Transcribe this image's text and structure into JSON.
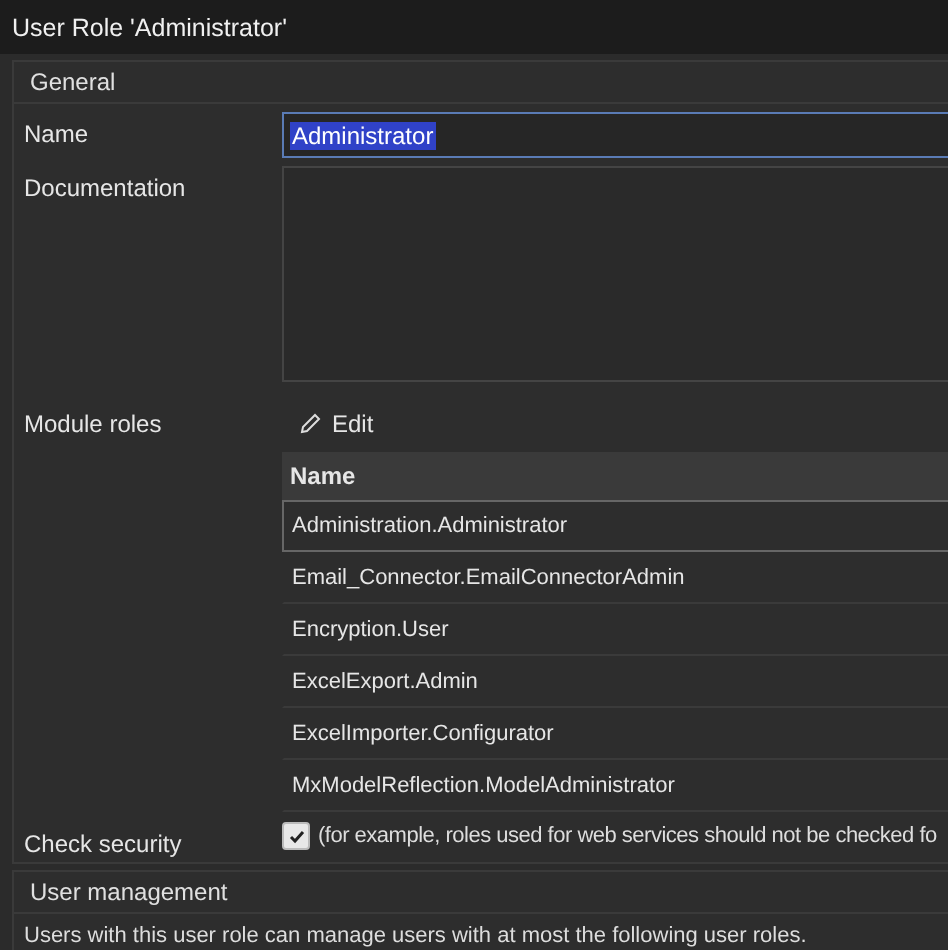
{
  "window": {
    "title": "User Role 'Administrator'"
  },
  "general": {
    "title": "General",
    "name": {
      "label": "Name",
      "value": "Administrator",
      "text_selected": true
    },
    "documentation": {
      "label": "Documentation"
    },
    "module_roles": {
      "label": "Module roles",
      "edit": "Edit",
      "table": {
        "columns": [
          "Name"
        ],
        "rows": [
          {
            "name": "Administration.Administrator",
            "selected": true
          },
          {
            "name": "Email_Connector.EmailConnectorAdmin",
            "selected": false
          },
          {
            "name": "Encryption.User",
            "selected": false
          },
          {
            "name": "ExcelExport.Admin",
            "selected": false
          },
          {
            "name": "ExcelImporter.Configurator",
            "selected": false
          },
          {
            "name": "MxModelReflection.ModelAdministrator",
            "selected": false
          }
        ]
      }
    },
    "check_security": {
      "label": "Check security",
      "checked": true,
      "hint": "(for example, roles used for web services should not be checked fo"
    }
  },
  "user_management": {
    "title": "User management",
    "description": "Users with this user role can manage users with at most the following user roles."
  }
}
